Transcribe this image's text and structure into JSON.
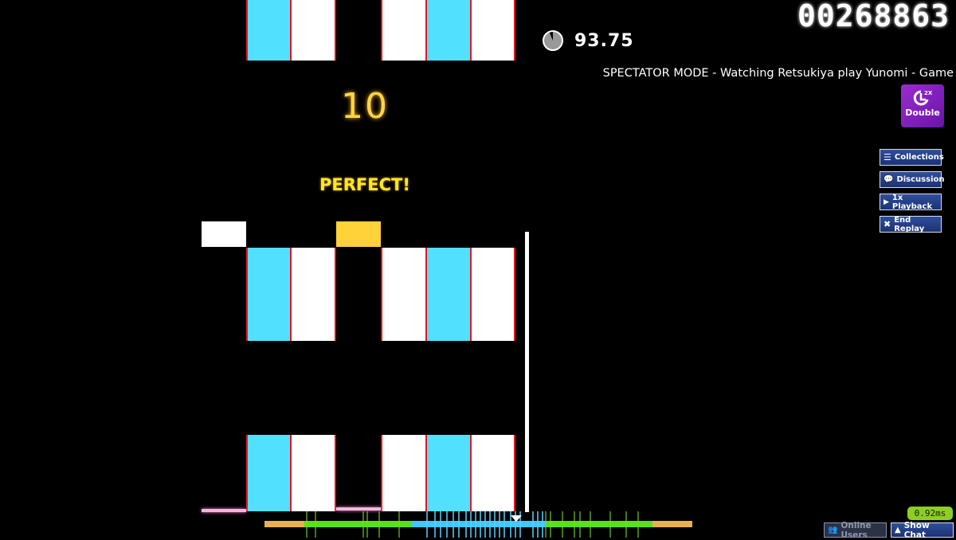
{
  "hud": {
    "score": "00268863",
    "accuracy": "93.75",
    "accuracy_fraction": 0.9375,
    "spectator_text": "SPECTATOR MODE - Watching Retsukiya play Yunomi - Game",
    "combo": "10",
    "judgement": "PERFECT!",
    "latency": "0.92ms"
  },
  "mods": [
    {
      "name": "Double",
      "badge": "2X",
      "color": "#8a22c4"
    }
  ],
  "side_buttons": [
    {
      "label": "Collections",
      "icon": "list-icon"
    },
    {
      "label": "Discussion",
      "icon": "chat-bubbles-icon"
    },
    {
      "label": "1x Playback",
      "icon": "play-icon"
    },
    {
      "label": "End Replay",
      "icon": "close-icon"
    }
  ],
  "bottom_buttons": {
    "online_users": "Online Users",
    "show_chat": "Show Chat"
  },
  "colors": {
    "note_cyan": "#52e0ff",
    "note_white": "#ffffff",
    "note_border": "#e8141c",
    "key_pressed": "#ffd23a",
    "combo": "#ffd54a",
    "judgement": "#ffe628",
    "hit_green": "#58e01a",
    "hit_orange": "#e8b050",
    "hit_blue": "#3ec8ff"
  },
  "keys": [
    {
      "lane": 1,
      "state": "white"
    },
    {
      "lane": 4,
      "state": "pressed"
    }
  ]
}
